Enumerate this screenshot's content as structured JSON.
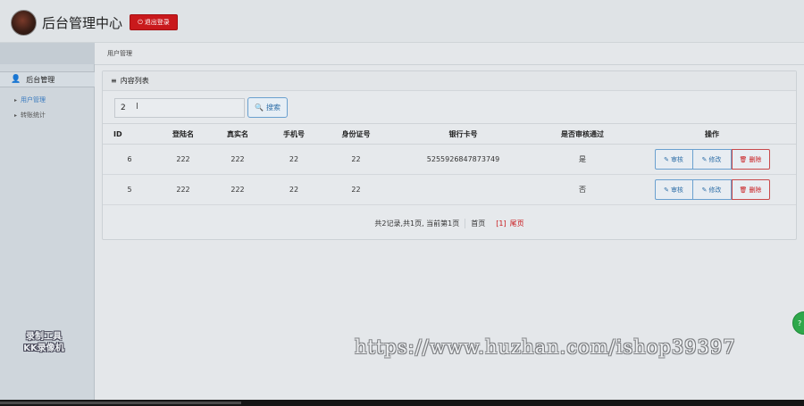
{
  "header": {
    "app_title": "后台管理中心",
    "logout_icon": "power-icon",
    "logout_label": "退出登录"
  },
  "sidebar": {
    "section_icon": "user-icon",
    "section_title": "后台管理",
    "items": [
      {
        "label": "用户管理",
        "active": true
      },
      {
        "label": "转账统计",
        "active": false
      }
    ],
    "watermark_logo": [
      "录制工具",
      "KK录像机"
    ]
  },
  "main": {
    "breadcrumb": "用户管理",
    "panel_title_icon": "list-icon",
    "panel_title": "内容列表",
    "search": {
      "value": "2",
      "button_label": "搜索",
      "button_icon": "search-icon"
    },
    "table": {
      "columns": [
        "ID",
        "登陆名",
        "真实名",
        "手机号",
        "身份证号",
        "银行卡号",
        "是否审核通过",
        "操作"
      ],
      "rows": [
        {
          "id": "6",
          "login": "222",
          "realname": "222",
          "phone": "22",
          "idcard": "22",
          "bank": "5255926847873749",
          "approved": "是"
        },
        {
          "id": "5",
          "login": "222",
          "realname": "222",
          "phone": "22",
          "idcard": "22",
          "bank": "",
          "approved": "否"
        }
      ],
      "actions": {
        "review": "审核",
        "edit": "修改",
        "delete": "删除"
      }
    },
    "pager": {
      "summary": "共2记录,共1页, 当前第1页",
      "first": "首页",
      "current": "[1]",
      "last": "尾页"
    }
  },
  "overlay": {
    "url_watermark": "https://www.huzhan.com/ishop39397",
    "float_button": "?"
  },
  "colors": {
    "danger": "#c9191c",
    "primary": "#2f6fa8",
    "float": "#2ea84b"
  }
}
